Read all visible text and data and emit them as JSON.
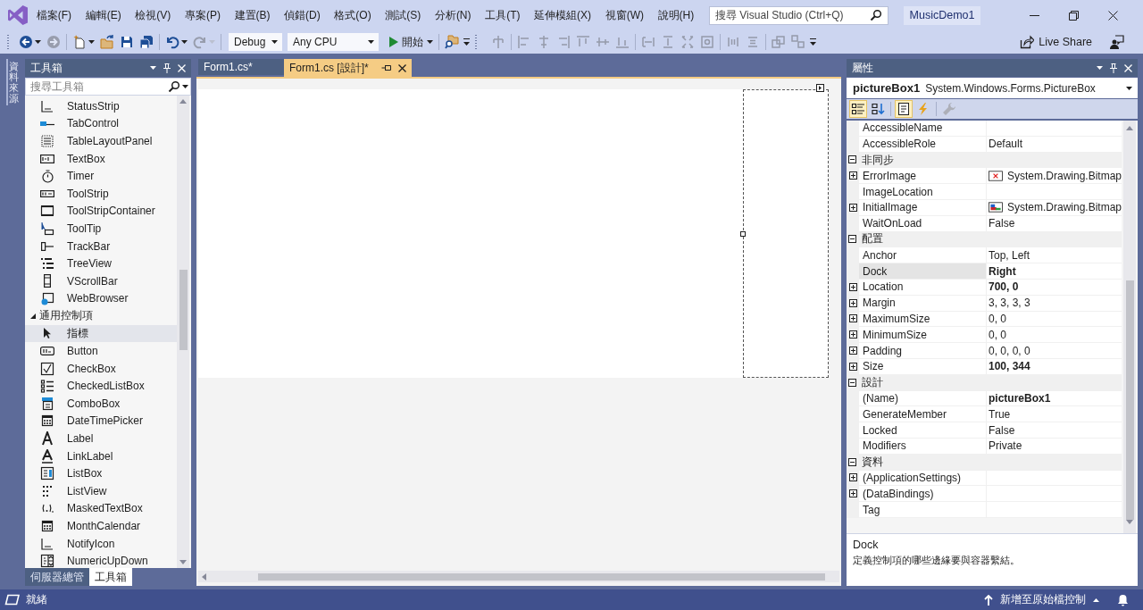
{
  "window": {
    "menu": [
      "檔案(F)",
      "編輯(E)",
      "檢視(V)",
      "專案(P)",
      "建置(B)",
      "偵錯(D)",
      "格式(O)",
      "測試(S)",
      "分析(N)",
      "工具(T)",
      "延伸模組(X)",
      "視窗(W)",
      "說明(H)"
    ],
    "search": {
      "placeholder": "搜尋 Visual Studio (Ctrl+Q)"
    },
    "solution_name": "MusicDemo1"
  },
  "toolbar": {
    "toolbars": [
      {
        "groups": [
          [
            {
              "kind": "icon",
              "dropdown": true,
              "disabled": false
            },
            {
              "kind": "icon",
              "dropdown": false,
              "disabled": true
            }
          ],
          [
            {
              "kind": "icon",
              "dropdown": true,
              "disabled": false
            },
            {
              "kind": "icon",
              "dropdown": false,
              "disabled": false
            },
            {
              "kind": "icon",
              "dropdown": false,
              "disabled": false
            },
            {
              "kind": "icon",
              "dropdown": false,
              "disabled": false
            }
          ],
          [
            {
              "kind": "icon",
              "dropdown": true,
              "disabled": false
            },
            {
              "kind": "icon",
              "dropdown": true,
              "disabled": true
            }
          ],
          [
            {
              "kind": "combo",
              "value": "Debug"
            },
            {
              "kind": "combo",
              "value": "Any CPU"
            },
            {
              "kind": "run",
              "label": "開始",
              "dropdown": true
            }
          ],
          [
            {
              "kind": "icon",
              "dropdown": false,
              "disabled": false
            }
          ]
        ]
      },
      {
        "groups": [
          [
            {
              "kind": "icon",
              "dropdown": false,
              "disabled": true
            }
          ],
          [
            {
              "kind": "icon",
              "dropdown": false,
              "disabled": true
            },
            {
              "kind": "icon",
              "dropdown": false,
              "disabled": true
            },
            {
              "kind": "icon",
              "dropdown": false,
              "disabled": true
            },
            {
              "kind": "icon",
              "dropdown": false,
              "disabled": true
            },
            {
              "kind": "icon",
              "dropdown": false,
              "disabled": true
            },
            {
              "kind": "icon",
              "dropdown": false,
              "disabled": true
            }
          ],
          [
            {
              "kind": "icon",
              "dropdown": false,
              "disabled": true
            },
            {
              "kind": "icon",
              "dropdown": false,
              "disabled": true
            },
            {
              "kind": "icon",
              "dropdown": false,
              "disabled": true
            },
            {
              "kind": "icon",
              "dropdown": false,
              "disabled": true
            }
          ],
          [
            {
              "kind": "icon",
              "dropdown": false,
              "disabled": true
            },
            {
              "kind": "icon",
              "dropdown": false,
              "disabled": true
            }
          ],
          [
            {
              "kind": "icon",
              "dropdown": false,
              "disabled": true
            },
            {
              "kind": "icon",
              "dropdown": false,
              "disabled": true
            }
          ]
        ]
      }
    ],
    "live_share": "Live Share"
  },
  "side_tabs": [
    {
      "label": "資料來源"
    }
  ],
  "toolbox": {
    "title": "工具箱",
    "search": {
      "placeholder": "搜尋工具箱"
    },
    "items": [
      {
        "label": "StatusStrip",
        "selected": false
      },
      {
        "label": "TabControl",
        "selected": false
      },
      {
        "label": "TableLayoutPanel",
        "selected": false
      },
      {
        "label": "TextBox",
        "selected": false
      },
      {
        "label": "Timer",
        "selected": false
      },
      {
        "label": "ToolStrip",
        "selected": false
      },
      {
        "label": "ToolStripContainer",
        "selected": false
      },
      {
        "label": "ToolTip",
        "selected": false
      },
      {
        "label": "TrackBar",
        "selected": false
      },
      {
        "label": "TreeView",
        "selected": false
      },
      {
        "label": "VScrollBar",
        "selected": false
      },
      {
        "label": "WebBrowser",
        "selected": false
      }
    ],
    "groups": [
      {
        "label": "通用控制項",
        "expanded": true,
        "items": [
          {
            "label": "指標",
            "selected": true
          },
          {
            "label": "Button",
            "selected": false
          },
          {
            "label": "CheckBox",
            "selected": false
          },
          {
            "label": "CheckedListBox",
            "selected": false
          },
          {
            "label": "ComboBox",
            "selected": false
          },
          {
            "label": "DateTimePicker",
            "selected": false
          },
          {
            "label": "Label",
            "selected": false
          },
          {
            "label": "LinkLabel",
            "selected": false
          },
          {
            "label": "ListBox",
            "selected": false
          },
          {
            "label": "ListView",
            "selected": false
          },
          {
            "label": "MaskedTextBox",
            "selected": false
          },
          {
            "label": "MonthCalendar",
            "selected": false
          },
          {
            "label": "NotifyIcon",
            "selected": false
          },
          {
            "label": "NumericUpDown",
            "selected": false
          }
        ]
      }
    ],
    "tabs": [
      {
        "label": "伺服器總管",
        "selected": false
      },
      {
        "label": "工具箱",
        "selected": true
      }
    ]
  },
  "document": {
    "tabs": [
      {
        "label": "Form1.cs*",
        "selected": false
      },
      {
        "label": "Form1.cs [設計]*",
        "selected": true
      }
    ]
  },
  "properties": {
    "title": "屬性",
    "object_name": "pictureBox1",
    "object_type": "System.Windows.Forms.PictureBox",
    "toolbar": [
      [
        {
          "selected": true,
          "disabled": false
        },
        {
          "selected": false,
          "disabled": false
        }
      ],
      [
        {
          "selected": true,
          "disabled": false
        },
        {
          "selected": false,
          "disabled": false
        }
      ],
      [
        {
          "selected": false,
          "disabled": true
        }
      ]
    ],
    "rows": [
      {
        "kind": "text",
        "name": "AccessibleName",
        "expandable": false,
        "selected": false
      },
      {
        "kind": "text",
        "name": "AccessibleRole",
        "value": "Default",
        "expandable": false,
        "modified": false,
        "selected": false
      },
      {
        "kind": "category",
        "label": "非同步",
        "expanded": true,
        "selected": false
      },
      {
        "kind": "broken",
        "name": "ErrorImage",
        "value": "System.Drawing.Bitmap",
        "expandable": true,
        "modified": false,
        "selected": false
      },
      {
        "kind": "text",
        "name": "ImageLocation",
        "expandable": false,
        "selected": false
      },
      {
        "kind": "image",
        "name": "InitialImage",
        "value": "System.Drawing.Bitmap",
        "expandable": true,
        "modified": false,
        "selected": false
      },
      {
        "kind": "text",
        "name": "WaitOnLoad",
        "value": "False",
        "expandable": false,
        "modified": false,
        "selected": false
      },
      {
        "kind": "category",
        "label": "配置",
        "expanded": true,
        "selected": false
      },
      {
        "kind": "text",
        "name": "Anchor",
        "value": "Top, Left",
        "expandable": false,
        "modified": false,
        "selected": false
      },
      {
        "kind": "text",
        "name": "Dock",
        "value": "Right",
        "expandable": false,
        "modified": true,
        "selected": true
      },
      {
        "kind": "text",
        "name": "Location",
        "value": "700, 0",
        "expandable": true,
        "modified": true,
        "selected": false
      },
      {
        "kind": "text",
        "name": "Margin",
        "value": "3, 3, 3, 3",
        "expandable": true,
        "modified": false,
        "selected": false
      },
      {
        "kind": "text",
        "name": "MaximumSize",
        "value": "0, 0",
        "expandable": true,
        "modified": false,
        "selected": false
      },
      {
        "kind": "text",
        "name": "MinimumSize",
        "value": "0, 0",
        "expandable": true,
        "modified": false,
        "selected": false
      },
      {
        "kind": "text",
        "name": "Padding",
        "value": "0, 0, 0, 0",
        "expandable": true,
        "modified": false,
        "selected": false
      },
      {
        "kind": "text",
        "name": "Size",
        "value": "100, 344",
        "expandable": true,
        "modified": true,
        "selected": false
      },
      {
        "kind": "category",
        "label": "設計",
        "expanded": true,
        "selected": false
      },
      {
        "kind": "text",
        "name": "(Name)",
        "value": "pictureBox1",
        "expandable": false,
        "modified": true,
        "selected": false
      },
      {
        "kind": "text",
        "name": "GenerateMember",
        "value": "True",
        "expandable": false,
        "modified": false,
        "selected": false
      },
      {
        "kind": "text",
        "name": "Locked",
        "value": "False",
        "expandable": false,
        "modified": false,
        "selected": false
      },
      {
        "kind": "text",
        "name": "Modifiers",
        "value": "Private",
        "expandable": false,
        "modified": false,
        "selected": false
      },
      {
        "kind": "category",
        "label": "資料",
        "expanded": true,
        "selected": false
      },
      {
        "kind": "text",
        "name": "(ApplicationSettings)",
        "expandable": true,
        "selected": false
      },
      {
        "kind": "text",
        "name": "(DataBindings)",
        "expandable": true,
        "selected": false
      },
      {
        "kind": "text",
        "name": "Tag",
        "expandable": false,
        "selected": false
      }
    ],
    "description": {
      "title": "Dock",
      "text": "定義控制項的哪些邊緣要與容器繫結。"
    }
  },
  "status_bar": {
    "text": "就緒",
    "source_control": "新增至原始檔控制"
  }
}
